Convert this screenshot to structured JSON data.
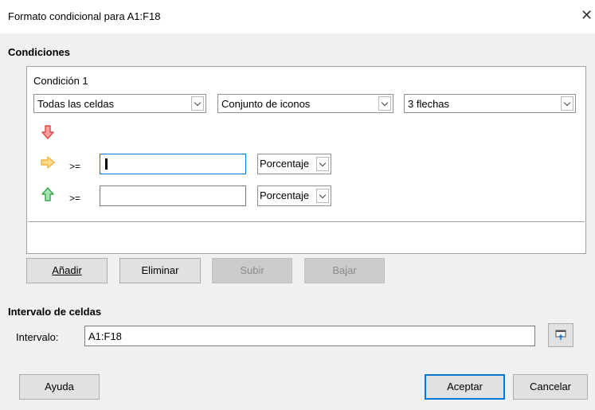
{
  "window": {
    "title": "Formato condicional para A1:F18",
    "close_glyph": "✕"
  },
  "conditions": {
    "section_label": "Condiciones",
    "condition_label": "Condición 1",
    "apply_to": "Todas las celdas",
    "type": "Conjunto de iconos",
    "icon_set": "3 flechas",
    "rows": [
      {
        "icon": "arrow-down-red-icon"
      },
      {
        "icon": "arrow-right-yellow-icon",
        "operator": ">=",
        "value": "",
        "unit": "Porcentaje"
      },
      {
        "icon": "arrow-up-green-icon",
        "operator": ">=",
        "value": "",
        "unit": "Porcentaje"
      }
    ]
  },
  "buttons": {
    "add": "Añadir",
    "delete": "Eliminar",
    "up": "Subir",
    "down": "Bajar",
    "help": "Ayuda",
    "ok": "Aceptar",
    "cancel": "Cancelar"
  },
  "range": {
    "section_label": "Intervalo de celdas",
    "label": "Intervalo:",
    "value": "A1:F18"
  },
  "colors": {
    "accent": "#0078d7",
    "arrow_red": "#e04848",
    "arrow_yellow": "#f2b23a",
    "arrow_green": "#3aa655"
  }
}
